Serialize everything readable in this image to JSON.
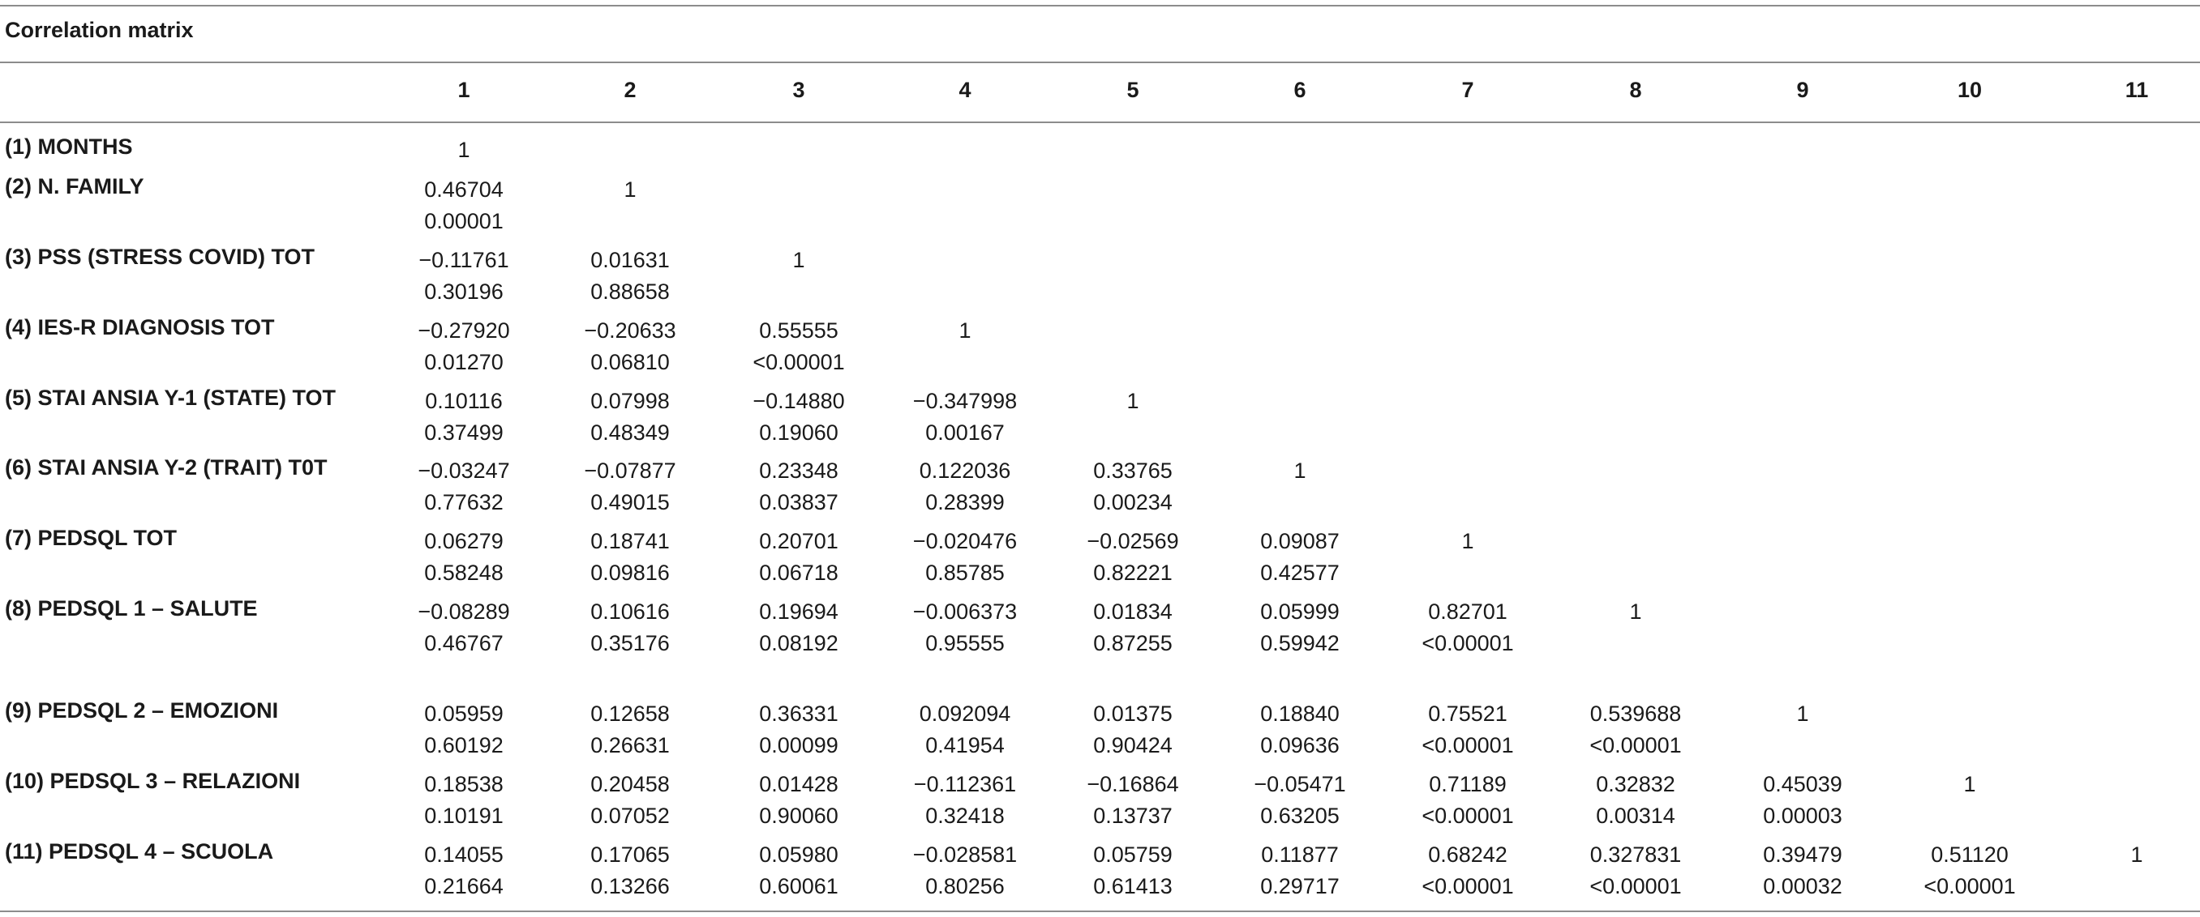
{
  "table": {
    "caption": "Correlation matrix",
    "columns": [
      "1",
      "2",
      "3",
      "4",
      "5",
      "6",
      "7",
      "8",
      "9",
      "10",
      "11"
    ],
    "rows": [
      {
        "label": "(1) MONTHS",
        "cells": [
          [
            "1",
            ""
          ]
        ]
      },
      {
        "label": "(2) N. FAMILY",
        "cells": [
          [
            "0.46704",
            "0.00001"
          ],
          [
            "1",
            ""
          ]
        ]
      },
      {
        "label": "(3) PSS (STRESS COVID) TOT",
        "cells": [
          [
            "−0.11761",
            "0.30196"
          ],
          [
            "0.01631",
            "0.88658"
          ],
          [
            "1",
            ""
          ]
        ]
      },
      {
        "label": "(4) IES-R DIAGNOSIS TOT",
        "cells": [
          [
            "−0.27920",
            "0.01270"
          ],
          [
            "−0.20633",
            "0.06810"
          ],
          [
            "0.55555",
            "<0.00001"
          ],
          [
            "1",
            ""
          ]
        ]
      },
      {
        "label": "(5) STAI ANSIA Y-1 (STATE) TOT",
        "cells": [
          [
            "0.10116",
            "0.37499"
          ],
          [
            "0.07998",
            "0.48349"
          ],
          [
            "−0.14880",
            "0.19060"
          ],
          [
            "−0.347998",
            "0.00167"
          ],
          [
            "1",
            ""
          ]
        ]
      },
      {
        "label": "(6) STAI ANSIA Y-2 (TRAIT) T0T",
        "cells": [
          [
            "−0.03247",
            "0.77632"
          ],
          [
            "−0.07877",
            "0.49015"
          ],
          [
            "0.23348",
            "0.03837"
          ],
          [
            "0.122036",
            "0.28399"
          ],
          [
            "0.33765",
            "0.00234"
          ],
          [
            "1",
            ""
          ]
        ]
      },
      {
        "label": "(7) PEDSQL TOT",
        "cells": [
          [
            "0.06279",
            "0.58248"
          ],
          [
            "0.18741",
            "0.09816"
          ],
          [
            "0.20701",
            "0.06718"
          ],
          [
            "−0.020476",
            "0.85785"
          ],
          [
            "−0.02569",
            "0.82221"
          ],
          [
            "0.09087",
            "0.42577"
          ],
          [
            "1",
            ""
          ]
        ]
      },
      {
        "label": "(8) PEDSQL 1 – SALUTE",
        "cells": [
          [
            "−0.08289",
            "0.46767"
          ],
          [
            "0.10616",
            "0.35176"
          ],
          [
            "0.19694",
            "0.08192"
          ],
          [
            "−0.006373",
            "0.95555"
          ],
          [
            "0.01834",
            "0.87255"
          ],
          [
            "0.05999",
            "0.59942"
          ],
          [
            "0.82701",
            "<0.00001"
          ],
          [
            "1",
            ""
          ]
        ]
      },
      {
        "label": "(9) PEDSQL 2 – EMOZIONI",
        "cells": [
          [
            "0.05959",
            "0.60192"
          ],
          [
            "0.12658",
            "0.26631"
          ],
          [
            "0.36331",
            "0.00099"
          ],
          [
            "0.092094",
            "0.41954"
          ],
          [
            "0.01375",
            "0.90424"
          ],
          [
            "0.18840",
            "0.09636"
          ],
          [
            "0.75521",
            "<0.00001"
          ],
          [
            "0.539688",
            "<0.00001"
          ],
          [
            "1",
            ""
          ]
        ]
      },
      {
        "label": "(10) PEDSQL 3 – RELAZIONI",
        "cells": [
          [
            "0.18538",
            "0.10191"
          ],
          [
            "0.20458",
            "0.07052"
          ],
          [
            "0.01428",
            "0.90060"
          ],
          [
            "−0.112361",
            "0.32418"
          ],
          [
            "−0.16864",
            "0.13737"
          ],
          [
            "−0.05471",
            "0.63205"
          ],
          [
            "0.71189",
            "<0.00001"
          ],
          [
            "0.32832",
            "0.00314"
          ],
          [
            "0.45039",
            "0.00003"
          ],
          [
            "1",
            ""
          ]
        ]
      },
      {
        "label": "(11) PEDSQL 4 – SCUOLA",
        "cells": [
          [
            "0.14055",
            "0.21664"
          ],
          [
            "0.17065",
            "0.13266"
          ],
          [
            "0.05980",
            "0.60061"
          ],
          [
            "−0.028581",
            "0.80256"
          ],
          [
            "0.05759",
            "0.61413"
          ],
          [
            "0.11877",
            "0.29717"
          ],
          [
            "0.68242",
            "<0.00001"
          ],
          [
            "0.327831",
            "<0.00001"
          ],
          [
            "0.39479",
            "0.00032"
          ],
          [
            "0.51120",
            "<0.00001"
          ],
          [
            "1",
            ""
          ]
        ]
      }
    ]
  }
}
